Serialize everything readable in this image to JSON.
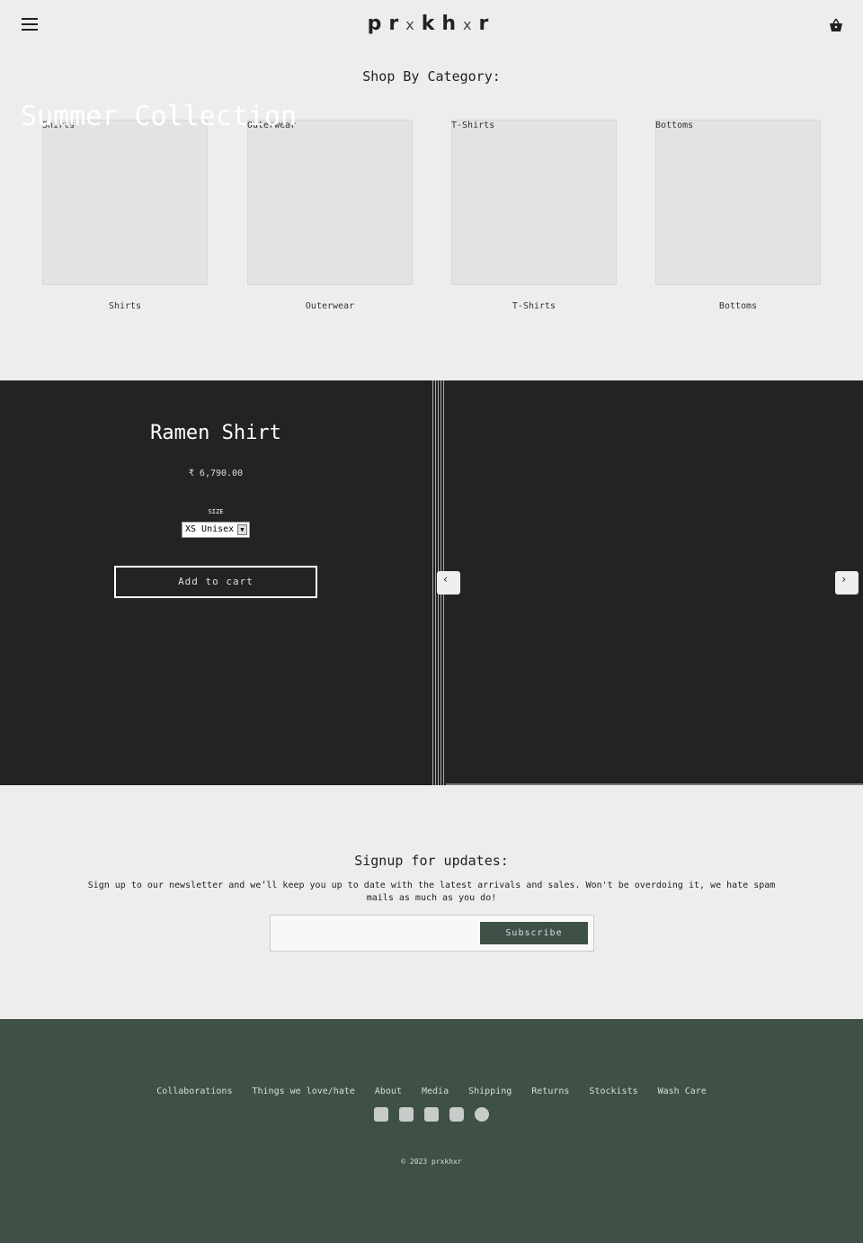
{
  "header": {
    "logo": [
      "p",
      "r",
      "x",
      "k",
      "h",
      "x",
      "r"
    ],
    "menu_icon": "hamburger-icon",
    "cart_icon": "basket-icon"
  },
  "shop": {
    "title": "Shop By Category:",
    "overlay": "Summer Collection",
    "categories": [
      {
        "tag": "Shirts",
        "label": "Shirts"
      },
      {
        "tag": "Outerwear",
        "label": "Outerwear"
      },
      {
        "tag": "T-Shirts",
        "label": "T-Shirts"
      },
      {
        "tag": "Bottoms",
        "label": "Bottoms"
      }
    ]
  },
  "product": {
    "title": "Ramen Shirt",
    "price": "₹ 6,790.00",
    "size_label": "SIZE",
    "size_value": "XS Unisex",
    "add_to_cart": "Add to cart",
    "prev": "‹",
    "next": "›"
  },
  "signup": {
    "title": "Signup for updates:",
    "text": "Sign up to our newsletter and we’ll keep you up to date with the latest arrivals and sales. Won't be overdoing it, we hate spam mails as much as you do!",
    "email_value": "",
    "subscribe": "Subscribe"
  },
  "footer": {
    "links": [
      "Collaborations",
      "Things we love/hate",
      "About",
      "Media",
      "Shipping",
      "Returns",
      "Stockists",
      "Wash Care"
    ],
    "social": [
      "twitter-icon",
      "facebook-icon",
      "youtube-icon",
      "instagram-icon",
      "pinterest-icon"
    ],
    "copyright": "© 2023 prxkhxr"
  },
  "colors": {
    "dark": "#232323",
    "footer": "#3f5147",
    "background": "#eeedeb"
  }
}
